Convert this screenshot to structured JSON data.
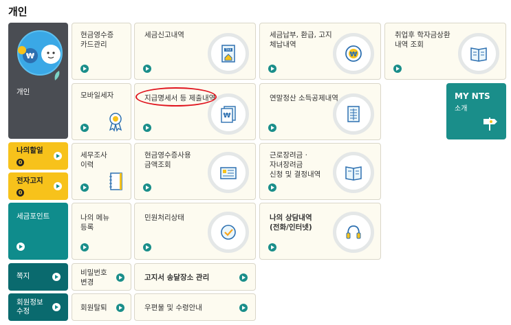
{
  "page": {
    "title": "개인"
  },
  "sidebar": {
    "personal": {
      "label": "개인"
    },
    "todo": {
      "label": "나의할일",
      "count": "0"
    },
    "notice": {
      "label": "전자고지",
      "count": "0"
    },
    "points": {
      "label": "세금포인트"
    },
    "memo": {
      "label": "쪽지"
    },
    "member": {
      "label": "회원정보\n수정"
    }
  },
  "tiles": {
    "cash_receipt": "현금영수증\n카드관리",
    "tax_report": "세금신고내역",
    "tax_payment": "세금납부, 환급, 고지\n체납내역",
    "student_loan": "취업후 학자금상환\n내역 조회",
    "mobile_tax": "모바일세자",
    "statement": "지급명세서 등 제출내역",
    "year_end": "연말정산 소득공제내역",
    "audit": "세무조사\n이력",
    "cash_amount": "현금영수증사용\n금액조회",
    "earned_credit": "근로장려금 ·\n자녀장려금\n신청 및 결정내역",
    "my_menu": "나의 메뉴\n등록",
    "petition": "민원처리상태",
    "consult": "나의 상담내역\n(전화/인터넷)",
    "password": "비밀번호\n변경",
    "bill_address": "고지서 송달장소 관리",
    "withdraw": "회원탈퇴",
    "mail_guide": "우편물 및 수령안내"
  },
  "mynts": {
    "title": "MY NTS",
    "subtitle": "소개"
  },
  "icons": {
    "tax_doc": "tax-document-icon",
    "won_coin": "won-coin-icon",
    "reader": "open-book-icon",
    "award": "award-ribbon-icon",
    "won_docs": "won-documents-icon",
    "ledger": "ledger-sheet-icon",
    "notebook": "notebook-icon",
    "list_doc": "list-document-icon",
    "check": "check-circle-icon",
    "headset": "headset-icon",
    "signpost": "signpost-icon"
  },
  "colors": {
    "accent": "#1a8e8a",
    "highlight": "#e0141e",
    "yellow": "#f7c21b",
    "dark": "#4a4d53"
  }
}
